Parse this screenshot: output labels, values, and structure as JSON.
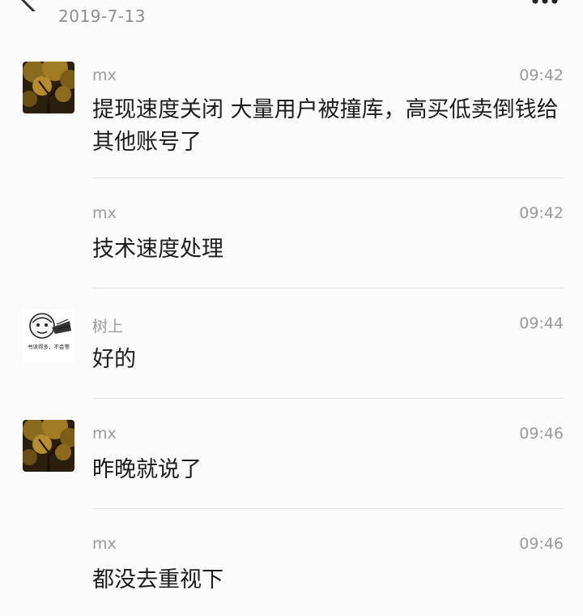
{
  "header": {
    "date": "2019-7-13",
    "back_icon": "chevron-left-icon",
    "more_icon": "more-dots-icon"
  },
  "messages": [
    {
      "sender": "mx",
      "time": "09:42",
      "text": "提现速度关闭 大量用户被撞库，高买低卖倒钱给其他账号了",
      "avatar": "autumn-tree-avatar"
    },
    {
      "sender": "mx",
      "time": "09:42",
      "text": "技术速度处理",
      "avatar": ""
    },
    {
      "sender": "树上",
      "time": "09:44",
      "text": "好的",
      "avatar": "meme-avatar",
      "avatar_caption": "书读得多，不会等"
    },
    {
      "sender": "mx",
      "time": "09:46",
      "text": "昨晚就说了",
      "avatar": "autumn-tree-avatar"
    },
    {
      "sender": "mx",
      "time": "09:46",
      "text": "都没去重视下",
      "avatar": ""
    }
  ],
  "colors": {
    "background": "#fbfbfb",
    "secondary_text": "#9a9a9a",
    "primary_text": "#1c1c1c",
    "divider": "#e6e6e6"
  }
}
